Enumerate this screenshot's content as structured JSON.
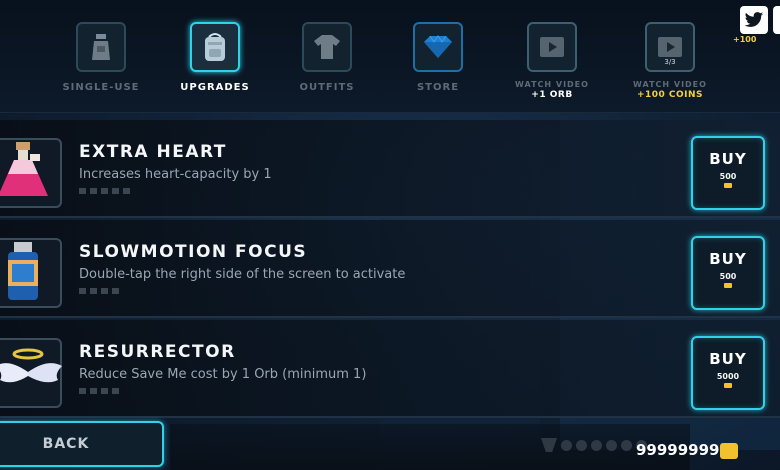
{
  "tabs": [
    {
      "label": "SINGLE-USE",
      "icon": "bottle-icon"
    },
    {
      "label": "UPGRADES",
      "icon": "backpack-icon",
      "active": true
    },
    {
      "label": "OUTFITS",
      "icon": "shirt-icon"
    },
    {
      "label": "STORE",
      "icon": "diamond-icon"
    },
    {
      "label": "WATCH VIDEO",
      "reward": "+1 ORB",
      "icon": "video-icon"
    },
    {
      "label": "WATCH VIDEO",
      "reward": "+100 COINS",
      "counter": "3/3",
      "icon": "video-icon"
    }
  ],
  "twitter": {
    "reward": "+100"
  },
  "items": [
    {
      "name": "EXTRA HEART",
      "description": "Increases heart-capacity by 1",
      "buy_label": "BUY",
      "price": "500",
      "icon": "heart-potion-icon",
      "level": 0,
      "max_level": 5
    },
    {
      "name": "SLOWMOTION FOCUS",
      "description": "Double-tap the right side of the screen to activate",
      "buy_label": "BUY",
      "price": "500",
      "icon": "canister-icon",
      "level": 0,
      "max_level": 4
    },
    {
      "name": "RESURRECTOR",
      "description": "Reduce Save Me cost by 1 Orb (minimum 1)",
      "buy_label": "BUY",
      "price": "5000",
      "icon": "angel-wings-icon",
      "level": 0,
      "max_level": 4
    }
  ],
  "back_label": "BACK",
  "coins": "99999999",
  "colors": {
    "accent": "#2fd2e8",
    "coin": "#f2c12e"
  }
}
